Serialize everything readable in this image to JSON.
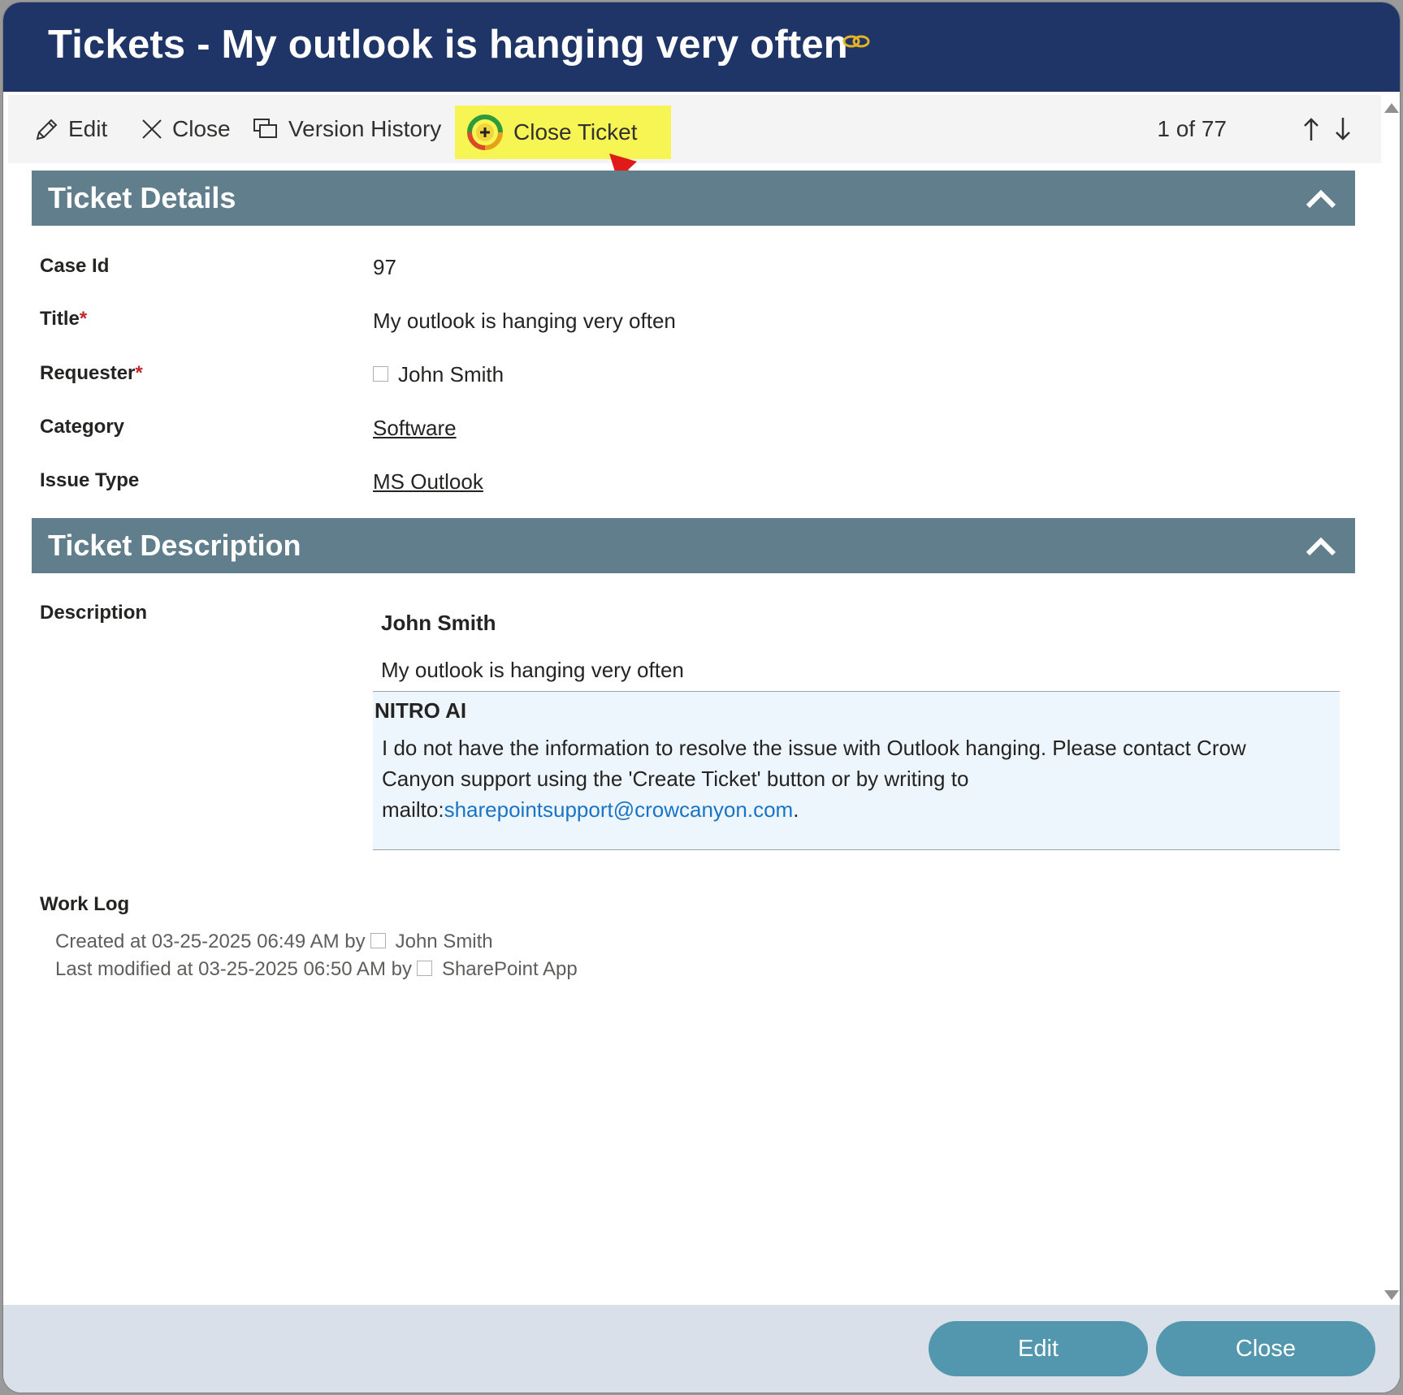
{
  "dialog": {
    "title": "Tickets - My outlook is hanging very often",
    "link_icon": "link-icon"
  },
  "toolbar": {
    "edit_label": "Edit",
    "close_label": "Close",
    "version_history_label": "Version History",
    "close_ticket_label": "Close Ticket",
    "pager": "1 of 77",
    "highlight_color": "#f6f553"
  },
  "sections": {
    "details_title": "Ticket Details",
    "description_title": "Ticket Description"
  },
  "fields": {
    "case_id_label": "Case Id",
    "case_id_value": "97",
    "title_label": "Title",
    "title_value": "My outlook is hanging very often",
    "requester_label": "Requester",
    "requester_value": "John Smith",
    "category_label": "Category",
    "category_value": "Software",
    "issue_type_label": "Issue Type",
    "issue_type_value": "MS Outlook",
    "required_marker": "*"
  },
  "description": {
    "label": "Description",
    "author": "John Smith",
    "text": "My outlook is hanging very often",
    "ai_title": "NITRO AI",
    "ai_body_line1": "I do not have the information to resolve the issue with Outlook hanging. Please contact Crow Canyon support using the 'Create Ticket' button or by writing to",
    "ai_body_prefix": "mailto:",
    "ai_email": "sharepointsupport@crowcanyon.com",
    "ai_body_suffix": "."
  },
  "worklog": {
    "label": "Work Log",
    "created_prefix": "Created at 03-25-2025 06:49 AM by",
    "created_by": "John Smith",
    "modified_prefix": "Last modified at 03-25-2025 06:50 AM by",
    "modified_by": "SharePoint App"
  },
  "footer": {
    "edit_label": "Edit",
    "close_label": "Close"
  },
  "colors": {
    "title_bar": "#1f3467",
    "section_header": "#617e8c",
    "footer_button": "#5297ad",
    "link": "#1a74c5"
  }
}
